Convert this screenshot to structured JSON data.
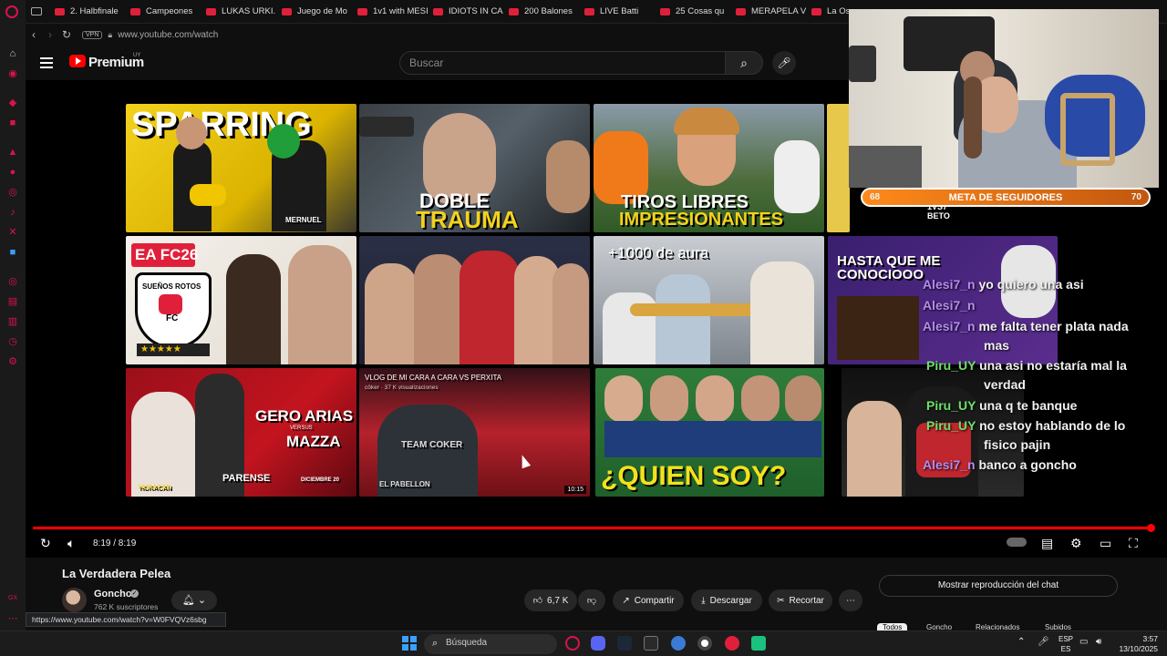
{
  "bookmarks": [
    "",
    "2. Halbfinale",
    "Campeones",
    "LUKAS URKI...",
    "Juego de Mo",
    "1v1 with MESI",
    "IDIOTS IN CA",
    "200 Balones",
    "LIVE Batti",
    "25 Cosas qu",
    "MERAPELA V",
    "La Oscu"
  ],
  "address": {
    "vpn": "VPN",
    "url": "www.youtube.com/watch"
  },
  "yt": {
    "brand": "Premium",
    "region": "UY",
    "search_placeholder": "Buscar"
  },
  "thumbs": {
    "t1": "SPARRING",
    "t1b": "MERNUEL",
    "t2a": "DOBLE",
    "t2b": "TRAUMA",
    "t3a": "TIROS LIBRES",
    "t3b": "IMPRESIONANTES",
    "t4a": "EA FC26",
    "t4b": "SUEÑOS ROTOS",
    "t4c": "FC",
    "t6": "+1000 de aura",
    "t7": "HASTA QUE ME CONOCIOOO",
    "t8a": "GERO ARIAS",
    "t8b": "VERSUS",
    "t8c": "MAZZA",
    "t8d": "PARENSE",
    "t8e": "DICIEMBRE 20",
    "t8f": "HURACAN",
    "t9a": "VLOG DE MI CARA A CARA VS PERXITA",
    "t9b": "cöker · 37 K visualizaciones",
    "t9c": "10:15",
    "t9d": "TEAM COKER",
    "t9e": "EL PABELLON",
    "t10": "¿QUIEN SOY?",
    "t11": "1VS7 BETO"
  },
  "player": {
    "time": "8:19 / 8:19",
    "progress_pct": 100
  },
  "video": {
    "title": "La Verdadera Pelea",
    "channel": "Goncho",
    "subscribers": "762 K suscriptores",
    "likes": "6,7 K",
    "share": "Compartir",
    "download": "Descargar",
    "clip": "Recortar",
    "chat_replay": "Mostrar reproducción del chat",
    "hover_url": "https://www.youtube.com/watch?v=W0FVQVz6sbg"
  },
  "chips": [
    "Todos",
    "Goncho",
    "Relacionados",
    "Subidos"
  ],
  "goal": {
    "label": "META DE SEGUIDORES",
    "current": "68",
    "target": "70"
  },
  "chat": [
    {
      "user": "Alesi7_n",
      "text": "yo quiero una asi",
      "color": "purple"
    },
    {
      "user": "Alesi7_n",
      "text": "",
      "color": "purple"
    },
    {
      "user": "Alesi7_n",
      "text": "me falta tener plata nada",
      "text2": "mas",
      "color": "purple"
    },
    {
      "user": "Piru_UY",
      "text": "una asi no estaría mal la",
      "text2": "verdad",
      "color": "green"
    },
    {
      "user": "Piru_UY",
      "text": "una q te banque",
      "color": "green"
    },
    {
      "user": "Piru_UY",
      "text": "no estoy hablando de lo",
      "text2": "fisico pajin",
      "color": "green"
    },
    {
      "user": "Alesi7_n",
      "text": "banco a goncho",
      "color": "purple"
    }
  ],
  "taskbar": {
    "search": "Búsqueda",
    "lang1": "ESP",
    "lang2": "ES",
    "time": "3:57",
    "date": "13/10/2025"
  }
}
